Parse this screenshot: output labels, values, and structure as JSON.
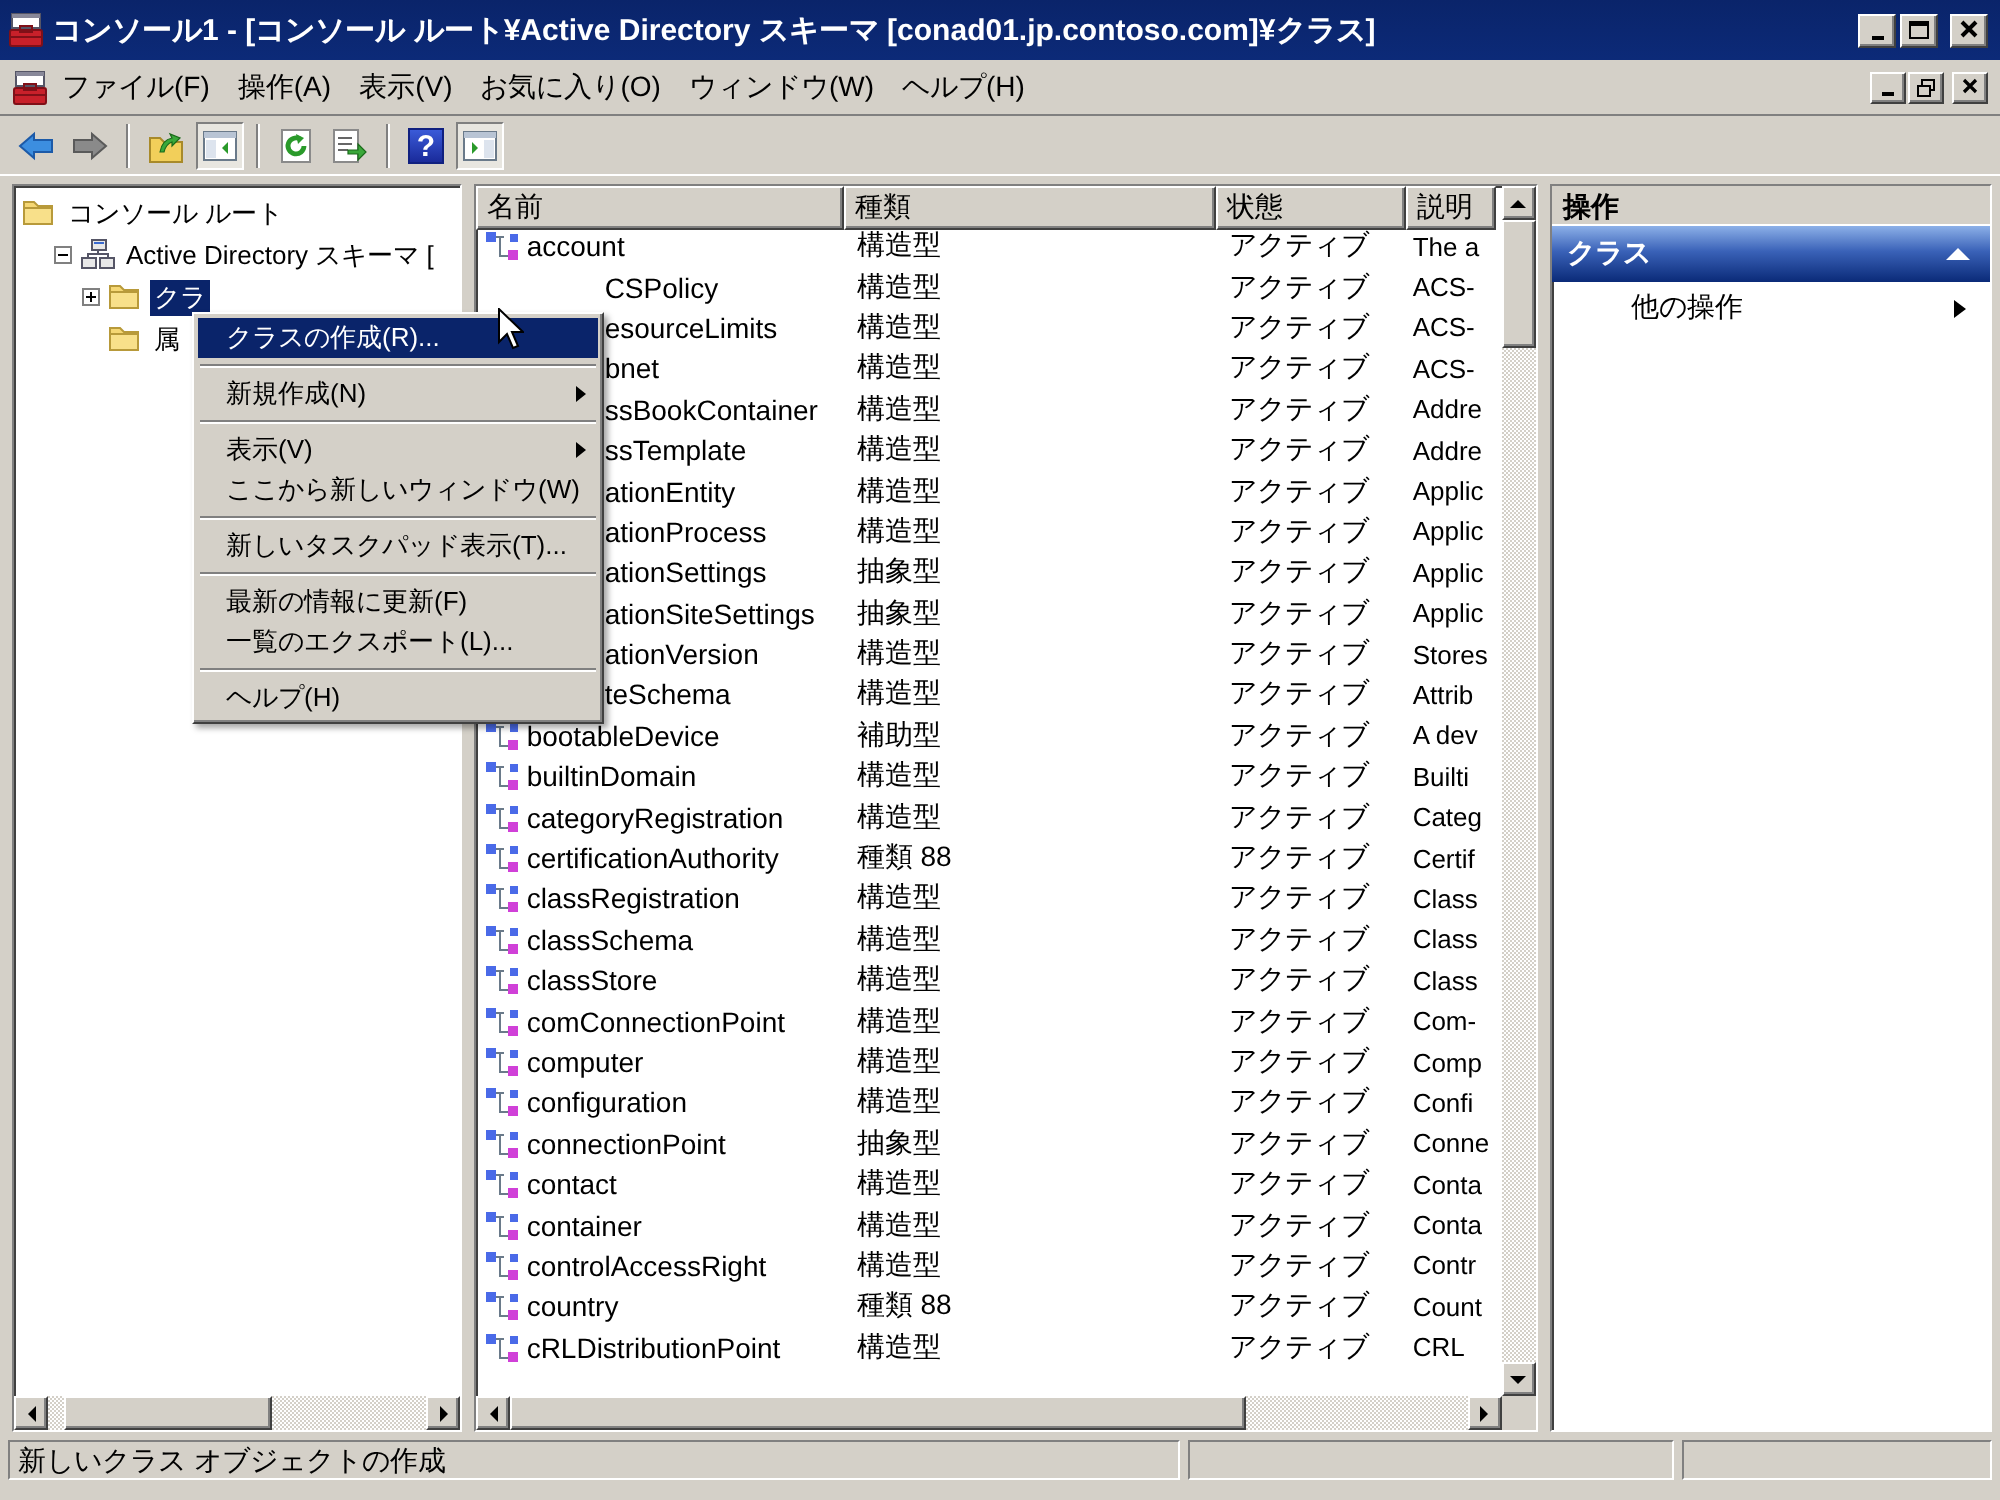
{
  "window": {
    "title": "コンソール1 - [コンソール ルート¥Active Directory スキーマ [conad01.jp.contoso.com]¥クラス]"
  },
  "menu_bar": [
    "ファイル(F)",
    "操作(A)",
    "表示(V)",
    "お気に入り(O)",
    "ウィンドウ(W)",
    "ヘルプ(H)"
  ],
  "toolbar": [
    {
      "kind": "back",
      "pressed": false
    },
    {
      "kind": "forward",
      "pressed": false
    },
    {
      "kind": "separator"
    },
    {
      "kind": "up",
      "pressed": false
    },
    {
      "kind": "tree-pane",
      "pressed": true
    },
    {
      "kind": "separator"
    },
    {
      "kind": "refresh",
      "pressed": false
    },
    {
      "kind": "export",
      "pressed": false
    },
    {
      "kind": "separator"
    },
    {
      "kind": "help",
      "text": "?",
      "pressed": false
    },
    {
      "kind": "action-pane",
      "pressed": true
    }
  ],
  "tree": [
    {
      "label": "コンソール ルート",
      "kind": "folder",
      "selected": false,
      "children": [
        {
          "label": "Active Directory スキーマ [",
          "kind": "schema",
          "selected": false,
          "expanded": true,
          "children": [
            {
              "label": "クラ",
              "kind": "folder",
              "selected": true,
              "expanded": false
            },
            {
              "label": "属",
              "kind": "folder",
              "selected": false
            }
          ]
        }
      ]
    }
  ],
  "columns": [
    "名前",
    "種類",
    "状態",
    "説明"
  ],
  "rows": [
    {
      "kind": "full",
      "name": "account",
      "type": "構造型",
      "state": "アクティブ",
      "description": "The a"
    },
    {
      "kind": "covered",
      "name": "CSPolicy",
      "type": "構造型",
      "state": "アクティブ",
      "description": "ACS-"
    },
    {
      "kind": "covered",
      "name": "esourceLimits",
      "type": "構造型",
      "state": "アクティブ",
      "description": "ACS-"
    },
    {
      "kind": "covered",
      "name": "bnet",
      "type": "構造型",
      "state": "アクティブ",
      "description": "ACS-"
    },
    {
      "kind": "covered",
      "name": "ssBookContainer",
      "type": "構造型",
      "state": "アクティブ",
      "description": "Addre"
    },
    {
      "kind": "covered",
      "name": "ssTemplate",
      "type": "構造型",
      "state": "アクティブ",
      "description": "Addre"
    },
    {
      "kind": "covered",
      "name": "ationEntity",
      "type": "構造型",
      "state": "アクティブ",
      "description": "Applic"
    },
    {
      "kind": "covered",
      "name": "ationProcess",
      "type": "構造型",
      "state": "アクティブ",
      "description": "Applic"
    },
    {
      "kind": "covered",
      "name": "ationSettings",
      "type": "抽象型",
      "state": "アクティブ",
      "description": "Applic"
    },
    {
      "kind": "covered",
      "name": "ationSiteSettings",
      "type": "抽象型",
      "state": "アクティブ",
      "description": "Applic"
    },
    {
      "kind": "covered",
      "name": "ationVersion",
      "type": "構造型",
      "state": "アクティブ",
      "description": "Stores"
    },
    {
      "kind": "covered",
      "name": "teSchema",
      "type": "構造型",
      "state": "アクティブ",
      "description": "Attrib"
    },
    {
      "kind": "full",
      "name": "bootableDevice",
      "type": "補助型",
      "state": "アクティブ",
      "description": "A dev"
    },
    {
      "kind": "full",
      "name": "builtinDomain",
      "type": "構造型",
      "state": "アクティブ",
      "description": "Builti"
    },
    {
      "kind": "full",
      "name": "categoryRegistration",
      "type": "構造型",
      "state": "アクティブ",
      "description": "Categ"
    },
    {
      "kind": "full",
      "name": "certificationAuthority",
      "type": "種類 88",
      "state": "アクティブ",
      "description": "Certif"
    },
    {
      "kind": "full",
      "name": "classRegistration",
      "type": "構造型",
      "state": "アクティブ",
      "description": "Class"
    },
    {
      "kind": "full",
      "name": "classSchema",
      "type": "構造型",
      "state": "アクティブ",
      "description": "Class"
    },
    {
      "kind": "full",
      "name": "classStore",
      "type": "構造型",
      "state": "アクティブ",
      "description": "Class"
    },
    {
      "kind": "full",
      "name": "comConnectionPoint",
      "type": "構造型",
      "state": "アクティブ",
      "description": "Com-"
    },
    {
      "kind": "full",
      "name": "computer",
      "type": "構造型",
      "state": "アクティブ",
      "description": "Comp"
    },
    {
      "kind": "full",
      "name": "configuration",
      "type": "構造型",
      "state": "アクティブ",
      "description": "Confi"
    },
    {
      "kind": "full",
      "name": "connectionPoint",
      "type": "抽象型",
      "state": "アクティブ",
      "description": "Conne"
    },
    {
      "kind": "full",
      "name": "contact",
      "type": "構造型",
      "state": "アクティブ",
      "description": "Conta"
    },
    {
      "kind": "full",
      "name": "container",
      "type": "構造型",
      "state": "アクティブ",
      "description": "Conta"
    },
    {
      "kind": "full",
      "name": "controlAccessRight",
      "type": "構造型",
      "state": "アクティブ",
      "description": "Contr"
    },
    {
      "kind": "full",
      "name": "country",
      "type": "種類 88",
      "state": "アクティブ",
      "description": "Count"
    },
    {
      "kind": "full",
      "name": "cRLDistributionPoint",
      "type": "構造型",
      "state": "アクティブ",
      "description": "CRL"
    }
  ],
  "context_menu": [
    [
      {
        "label": "クラスの作成(R)...",
        "selected": true,
        "submenu": false
      }
    ],
    [
      {
        "label": "新規作成(N)",
        "selected": false,
        "submenu": true
      }
    ],
    [
      {
        "label": "表示(V)",
        "selected": false,
        "submenu": true
      },
      {
        "label": "ここから新しいウィンドウ(W)",
        "selected": false,
        "submenu": false
      }
    ],
    [
      {
        "label": "新しいタスクパッド表示(T)...",
        "selected": false,
        "submenu": false
      }
    ],
    [
      {
        "label": "最新の情報に更新(F)",
        "selected": false,
        "submenu": false
      },
      {
        "label": "一覧のエクスポート(L)...",
        "selected": false,
        "submenu": false
      }
    ],
    [
      {
        "label": "ヘルプ(H)",
        "selected": false,
        "submenu": false
      }
    ]
  ],
  "actions": {
    "title": "操作",
    "section": {
      "label": "クラス",
      "expanded": true
    },
    "items": [
      {
        "label": "他の操作",
        "submenu": true
      }
    ]
  },
  "status_bar": [
    "新しいクラス オブジェクトの作成"
  ]
}
